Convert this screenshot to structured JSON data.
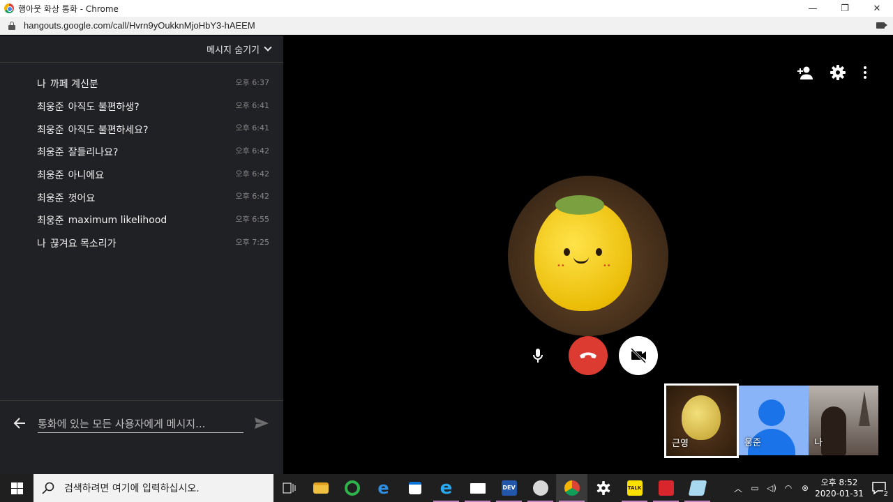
{
  "window": {
    "title": "행아웃 화상 통화 - Chrome",
    "minimize": "—",
    "restore": "❐",
    "close": "✕"
  },
  "address_bar": {
    "url": "hangouts.google.com/call/Hvrn9yOukknMjoHbY3-hAEEM"
  },
  "chat": {
    "hide_label": "메시지 숨기기",
    "messages": [
      {
        "sender": "나",
        "text": "까페 계신분",
        "time": "오후 6:37"
      },
      {
        "sender": "최웅준",
        "text": "아직도 불편하생?",
        "time": "오후 6:41"
      },
      {
        "sender": "최웅준",
        "text": "아직도 불편하세요?",
        "time": "오후 6:41"
      },
      {
        "sender": "최웅준",
        "text": "잘들리나요?",
        "time": "오후 6:42"
      },
      {
        "sender": "최웅준",
        "text": "아니에요",
        "time": "오후 6:42"
      },
      {
        "sender": "최웅준",
        "text": "껏어요",
        "time": "오후 6:42"
      },
      {
        "sender": "최웅준",
        "text": "maximum likelihood",
        "time": "오후 6:55"
      },
      {
        "sender": "나",
        "text": "끊겨요 목소리가",
        "time": "오후 7:25"
      }
    ],
    "input_placeholder": "통화에 있는 모든 사용자에게 메시지..."
  },
  "participants": [
    {
      "label": "근영",
      "active": true
    },
    {
      "label": "웅준",
      "active": false
    },
    {
      "label": "나",
      "active": false
    }
  ],
  "taskbar": {
    "search_placeholder": "검색하려면 여기에 입력하십시오.",
    "clock_time": "오후 8:52",
    "clock_date": "2020-01-31",
    "notification_count": "2",
    "kakao_label": "TALK",
    "dev_label": "DEV"
  }
}
